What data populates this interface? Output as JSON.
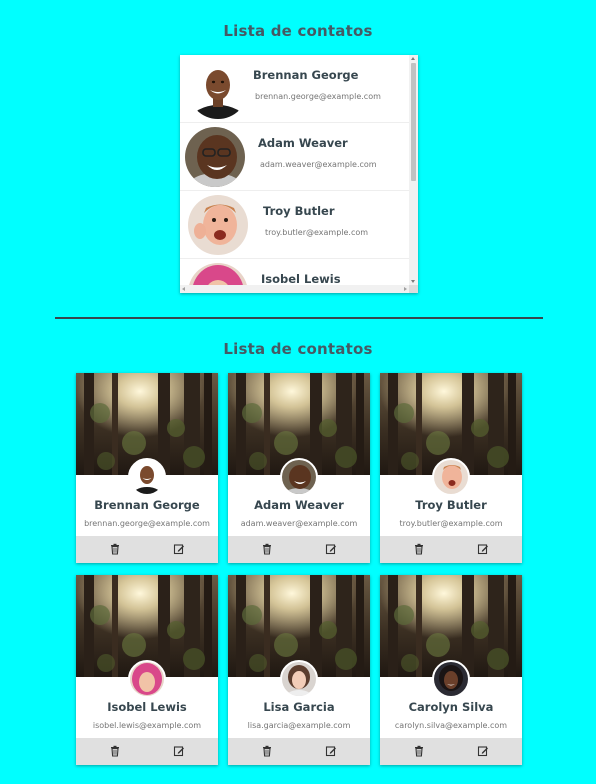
{
  "section1": {
    "title": "Lista de contatos"
  },
  "section2": {
    "title": "Lista de contatos"
  },
  "list": [
    {
      "name": "Brennan George",
      "email": "brennan.george@example.com"
    },
    {
      "name": "Adam Weaver",
      "email": "adam.weaver@example.com"
    },
    {
      "name": "Troy Butler",
      "email": "troy.butler@example.com"
    },
    {
      "name": "Isobel Lewis",
      "email": "isobel.lewis@example.com"
    }
  ],
  "cards": [
    {
      "name": "Brennan George",
      "email": "brennan.george@example.com"
    },
    {
      "name": "Adam Weaver",
      "email": "adam.weaver@example.com"
    },
    {
      "name": "Troy Butler",
      "email": "troy.butler@example.com"
    },
    {
      "name": "Isobel Lewis",
      "email": "isobel.lewis@example.com"
    },
    {
      "name": "Lisa Garcia",
      "email": "lisa.garcia@example.com"
    },
    {
      "name": "Carolyn Silva",
      "email": "carolyn.silva@example.com"
    }
  ],
  "icons": {
    "delete": "trash-icon",
    "edit": "edit-icon"
  },
  "colors": {
    "background": "#00ffff",
    "text": "#37474f",
    "action_bar": "#e0e0e0"
  }
}
